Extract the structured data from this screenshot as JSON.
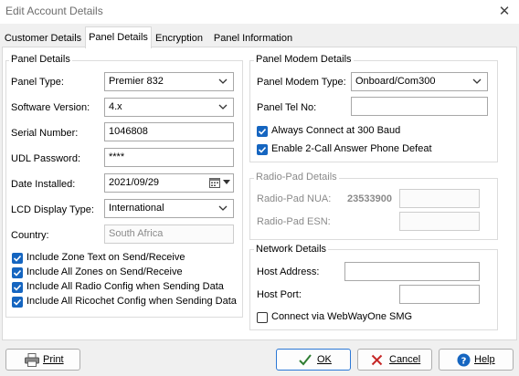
{
  "window": {
    "title": "Edit Account Details"
  },
  "tabs": [
    {
      "label": "Customer Details"
    },
    {
      "label": "Panel Details"
    },
    {
      "label": "Encryption"
    },
    {
      "label": "Panel Information"
    }
  ],
  "panel_details": {
    "group_label": "Panel Details",
    "panel_type_label": "Panel Type:",
    "panel_type_value": "Premier 832",
    "software_version_label": "Software Version:",
    "software_version_value": "4.x",
    "serial_number_label": "Serial Number:",
    "serial_number_value": "1046808",
    "udl_password_label": "UDL Password:",
    "udl_password_value": "****",
    "date_installed_label": "Date Installed:",
    "date_installed_value": "2021/09/29",
    "lcd_display_type_label": "LCD Display Type:",
    "lcd_display_type_value": "International",
    "country_label": "Country:",
    "country_value": "South Africa",
    "checkboxes": [
      {
        "label": "Include Zone Text on Send/Receive",
        "checked": true
      },
      {
        "label": "Include All Zones on Send/Receive",
        "checked": true
      },
      {
        "label": "Include All Radio Config when Sending Data",
        "checked": true
      },
      {
        "label": "Include All Ricochet Config when Sending Data",
        "checked": true
      }
    ]
  },
  "panel_modem": {
    "group_label": "Panel Modem Details",
    "modem_type_label": "Panel Modem Type:",
    "modem_type_value": "Onboard/Com300",
    "tel_no_label": "Panel Tel No:",
    "tel_no_value": "",
    "always_connect_label": "Always Connect at 300 Baud",
    "always_connect_checked": true,
    "two_call_label": "Enable 2-Call Answer Phone Defeat",
    "two_call_checked": true
  },
  "radio_pad": {
    "group_label": "Radio-Pad Details",
    "nua_label": "Radio-Pad NUA:",
    "nua_prefix": "23533900",
    "nua_value": "",
    "esn_label": "Radio-Pad ESN:",
    "esn_value": ""
  },
  "network": {
    "group_label": "Network Details",
    "host_address_label": "Host Address:",
    "host_address_value": "",
    "host_port_label": "Host Port:",
    "host_port_value": "",
    "webwayone_label": "Connect via WebWayOne SMG",
    "webwayone_checked": false
  },
  "buttons": {
    "print": "Print",
    "ok": "OK",
    "cancel": "Cancel",
    "help": "Help"
  },
  "colors": {
    "checkbox_checked": "#1565c0",
    "primary_button_border": "#2b78d6",
    "cancel_icon": "#c62828",
    "ok_icon": "#2e7d32",
    "help_icon": "#1565c0"
  }
}
